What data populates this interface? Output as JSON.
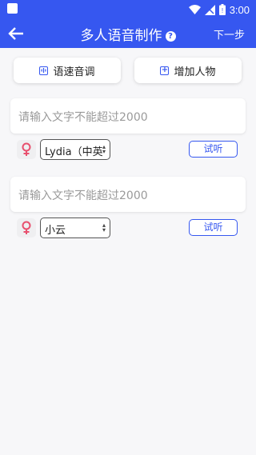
{
  "status_bar": {
    "time": "3:00",
    "icons": [
      "app-square-icon",
      "wifi-icon",
      "signal-icon",
      "battery-icon"
    ]
  },
  "app_bar": {
    "title": "多人语音制作",
    "help_symbol": "?",
    "next_label": "下一步",
    "background": "#3657f0"
  },
  "actions": {
    "speed_pitch_label": "语速音调",
    "add_person_label": "增加人物"
  },
  "entries": [
    {
      "placeholder": "请输入文字不能超过2000",
      "voice": "Lydia（中英",
      "listen_label": "试听"
    },
    {
      "placeholder": "请输入文字不能超过2000",
      "voice": "小云",
      "listen_label": "试听"
    }
  ],
  "colors": {
    "accent": "#3657f0",
    "female_icon": "#e8506e"
  }
}
